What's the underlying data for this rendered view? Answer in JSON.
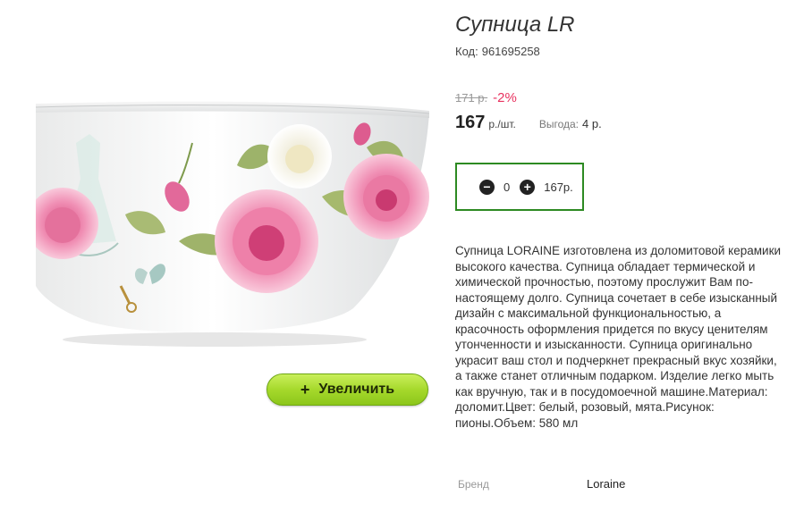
{
  "product": {
    "title": "Супница LR",
    "code_label": "Код:",
    "code_value": "961695258",
    "old_price": "171 р.",
    "discount": "-2%",
    "price_value": "167",
    "price_unit": "р./шт.",
    "benefit_label": "Выгода:",
    "benefit_value": "4 р.",
    "description": "Супница LORAINE изготовлена из доломитовой керамики высокого качества. Супница обладает термической и химической прочностью, поэтому прослужит Вам по-настоящему долго. Супница сочетает в себе изысканный дизайн с максимальной функциональностью, а красочность оформления придется по вкусу ценителям утонченности и изысканности. Супница оригинально украсит ваш стол и подчеркнет прекрасный вкус хозяйки, а также станет отличным подарком. Изделие легко мыть как вручную, так и в посудомоечной машине.Материал: доломит.Цвет: белый, розовый, мята.Рисунок: пионы.Объем: 580 мл",
    "brand_label": "Бренд",
    "brand_value": "Loraine"
  },
  "quantity": {
    "minus_icon": "minus-circle-icon",
    "value": "0",
    "plus_icon": "plus-circle-icon",
    "total": "167р."
  },
  "zoom": {
    "plus_glyph": "+",
    "label": "Увеличить"
  },
  "colors": {
    "discount": "#e8325f",
    "qty_border": "#2d8a22",
    "zoom_button": "#a6d92c"
  }
}
